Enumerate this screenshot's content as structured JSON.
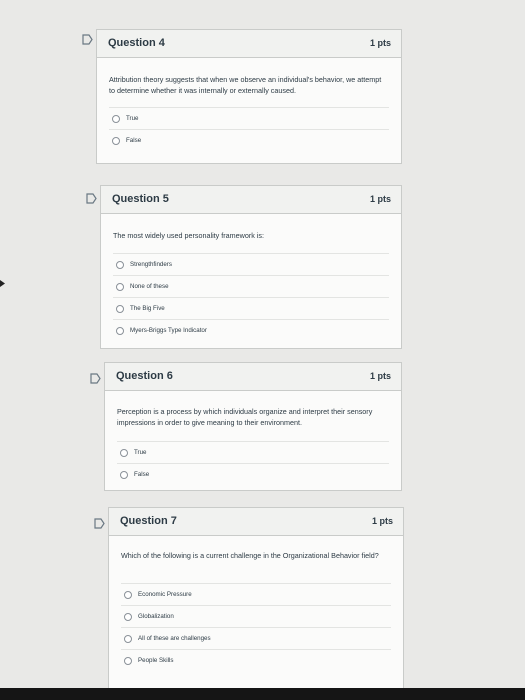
{
  "questions": [
    {
      "title": "Question 4",
      "points": "1 pts",
      "text": "Attribution theory suggests that when we observe an individual's behavior, we attempt to determine whether it was internally or externally caused.",
      "answers": [
        "True",
        "False"
      ]
    },
    {
      "title": "Question 5",
      "points": "1 pts",
      "text": "The most widely used personality framework is:",
      "answers": [
        "Strengthfinders",
        "None of these",
        "The Big Five",
        "Myers-Briggs Type Indicator"
      ]
    },
    {
      "title": "Question 6",
      "points": "1 pts",
      "text": "Perception is a process by which individuals organize and interpret their sensory impressions in order to give meaning to their environment.",
      "answers": [
        "True",
        "False"
      ]
    },
    {
      "title": "Question 7",
      "points": "1 pts",
      "text": "Which of the following is a current challenge in the Organizational Behavior field?",
      "answers": [
        "Economic Pressure",
        "Globalization",
        "All of these are challenges",
        "People Skills"
      ]
    }
  ]
}
